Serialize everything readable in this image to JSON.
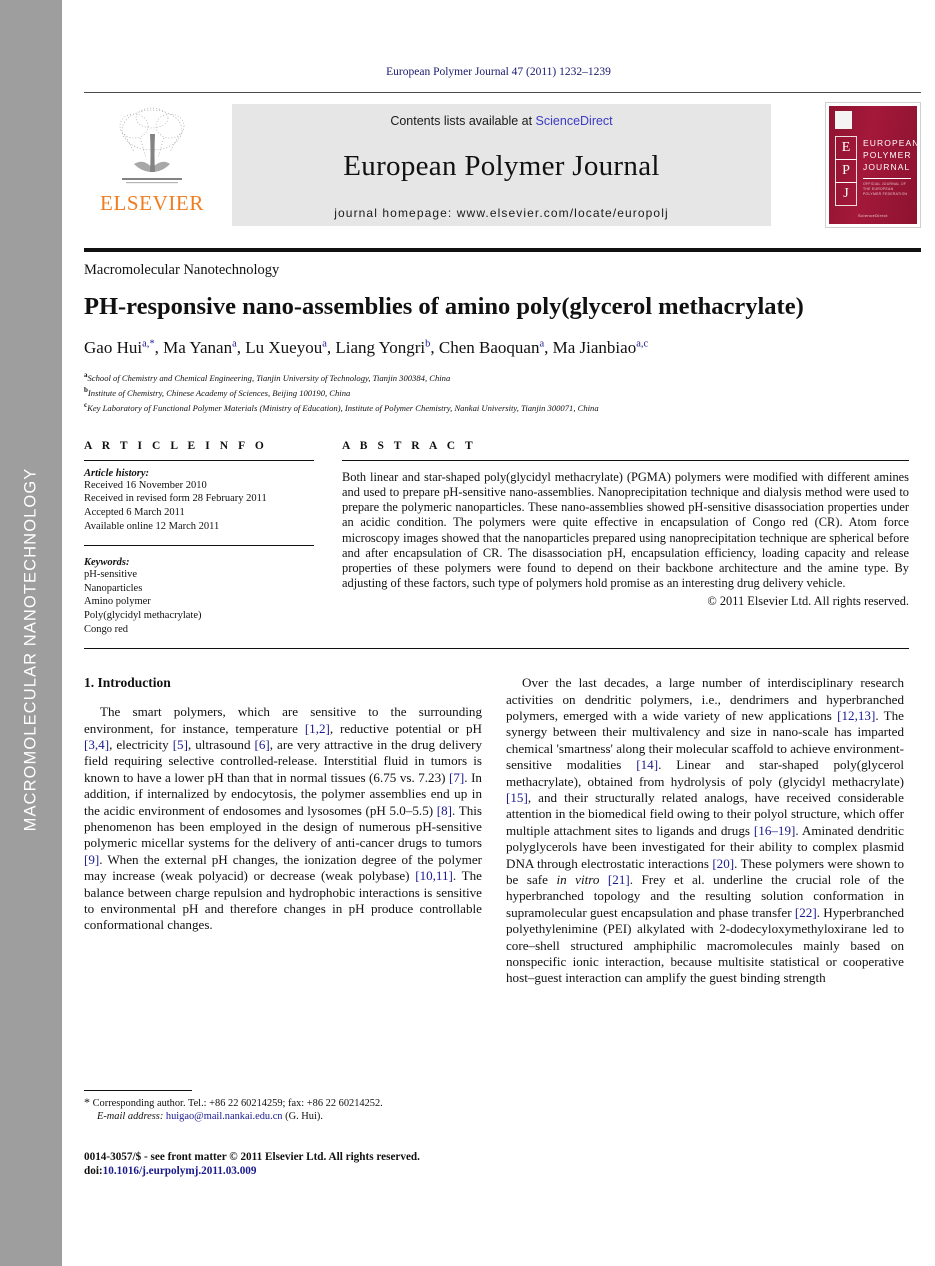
{
  "sidebar": {
    "vertical_label": "MACROMOLECULAR NANOTECHNOLOGY"
  },
  "header": {
    "journal_ref": "European Polymer Journal 47 (2011) 1232–1239",
    "publisher_wordmark": "ELSEVIER",
    "contents_prefix": "Contents lists available at ",
    "contents_link": "ScienceDirect",
    "journal_name": "European Polymer Journal",
    "homepage": "journal homepage: www.elsevier.com/locate/europolj",
    "cover": {
      "title_line1": "EUROPEAN",
      "title_line2": "POLYMER",
      "title_line3": "JOURNAL",
      "letters": [
        "E",
        "P",
        "J"
      ],
      "subtitle": "OFFICIAL JOURNAL OF THE EUROPEAN POLYMER FEDERATION",
      "bottom_mark": "ScienceDirect"
    },
    "colors": {
      "elsevier_orange": "#f07c1f",
      "link_blue": "#3b3bc4",
      "cover_red": "#9e1733",
      "sidebar_gray": "#9e9e9e"
    }
  },
  "article": {
    "kicker": "Macromolecular Nanotechnology",
    "title": "PH-responsive nano-assemblies of amino poly(glycerol methacrylate)",
    "authors_html": "Gao Hui<sup>a,*</sup>, Ma Yanan<sup>a</sup>, Lu Xueyou<sup>a</sup>, Liang Yongri<sup>b</sup>, Chen Baoquan<sup>a</sup>, Ma Jianbiao<sup>a,c</sup>",
    "affiliations": [
      "School of Chemistry and Chemical Engineering, Tianjin University of Technology, Tianjin 300384, China",
      "Institute of Chemistry, Chinese Academy of Sciences, Beijing 100190, China",
      "Key Laboratory of Functional Polymer Materials (Ministry of Education), Institute of Polymer Chemistry, Nankai University, Tianjin 300071, China"
    ],
    "affiliation_marks": [
      "a",
      "b",
      "c"
    ]
  },
  "article_info": {
    "heading": "A R T I C L E   I N F O",
    "history_label": "Article history:",
    "history": [
      "Received 16 November 2010",
      "Received in revised form 28 February 2011",
      "Accepted 6 March 2011",
      "Available online 12 March 2011"
    ],
    "keywords_label": "Keywords:",
    "keywords": [
      "pH-sensitive",
      "Nanoparticles",
      "Amino polymer",
      "Poly(glycidyl methacrylate)",
      "Congo red"
    ]
  },
  "abstract": {
    "heading": "A B S T R A C T",
    "text": "Both linear and star-shaped poly(glycidyl methacrylate) (PGMA) polymers were modified with different amines and used to prepare pH-sensitive nano-assemblies. Nanoprecipitation technique and dialysis method were used to prepare the polymeric nanoparticles. These nano-assemblies showed pH-sensitive disassociation properties under an acidic condition. The polymers were quite effective in encapsulation of Congo red (CR). Atom force microscopy images showed that the nanoparticles prepared using nanoprecipitation technique are spherical before and after encapsulation of CR. The disassociation pH, encapsulation efficiency, loading capacity and release properties of these polymers were found to depend on their backbone architecture and the amine type. By adjusting of these factors, such type of polymers hold promise as an interesting drug delivery vehicle.",
    "copyright": "© 2011 Elsevier Ltd. All rights reserved."
  },
  "body": {
    "section_number_title": "1. Introduction",
    "left_paragraphs": [
      "The smart polymers, which are sensitive to the surrounding environment, for instance, temperature [1,2], reductive potential or pH [3,4], electricity [5], ultrasound [6], are very attractive in the drug delivery field requiring selective controlled-release. Interstitial fluid in tumors is known to have a lower pH than that in normal tissues (6.75 vs. 7.23) [7]. In addition, if internalized by endocytosis, the polymer assemblies end up in the acidic environment of endosomes and lysosomes (pH 5.0–5.5) [8]. This phenomenon has been employed in the design of numerous pH-sensitive polymeric micellar systems for the delivery of anti-cancer drugs to tumors [9]. When the external pH changes, the ionization degree of the polymer may increase (weak polyacid) or decrease (weak polybase) [10,11]. The balance between charge repulsion and hydrophobic interactions is sensitive to environmental pH and therefore changes in pH produce controllable conformational changes."
    ],
    "right_paragraphs": [
      "Over the last decades, a large number of interdisciplinary research activities on dendritic polymers, i.e., dendrimers and hyperbranched polymers, emerged with a wide variety of new applications [12,13]. The synergy between their multivalency and size in nano-scale has imparted chemical 'smartness' along their molecular scaffold to achieve environment-sensitive modalities [14]. Linear and star-shaped poly(glycerol methacrylate), obtained from hydrolysis of poly (glycidyl methacrylate) [15], and their structurally related analogs, have received considerable attention in the biomedical field owing to their polyol structure, which offer multiple attachment sites to ligands and drugs [16–19]. Aminated dendritic polyglycerols have been investigated for their ability to complex plasmid DNA through electrostatic interactions [20]. These polymers were shown to be safe in vitro [21]. Frey et al. underline the crucial role of the hyperbranched topology and the resulting solution conformation in supramolecular guest encapsulation and phase transfer [22]. Hyperbranched polyethylenimine (PEI) alkylated with 2-dodecyloxymethyloxirane led to core–shell structured amphiphilic macromolecules mainly based on nonspecific ionic interaction, because multisite statistical or cooperative host–guest interaction can amplify the guest binding strength"
    ]
  },
  "footnotes": {
    "corresponding_marker": "*",
    "corresponding": "Corresponding author. Tel.: +86 22 60214259; fax: +86 22 60214252.",
    "email_label": "E-mail address:",
    "email": "huigao@mail.nankai.edu.cn",
    "email_suffix": "(G. Hui).",
    "issn_line": "0014-3057/$ - see front matter © 2011 Elsevier Ltd. All rights reserved.",
    "doi_label": "doi:",
    "doi": "10.1016/j.eurpolymj.2011.03.009"
  }
}
